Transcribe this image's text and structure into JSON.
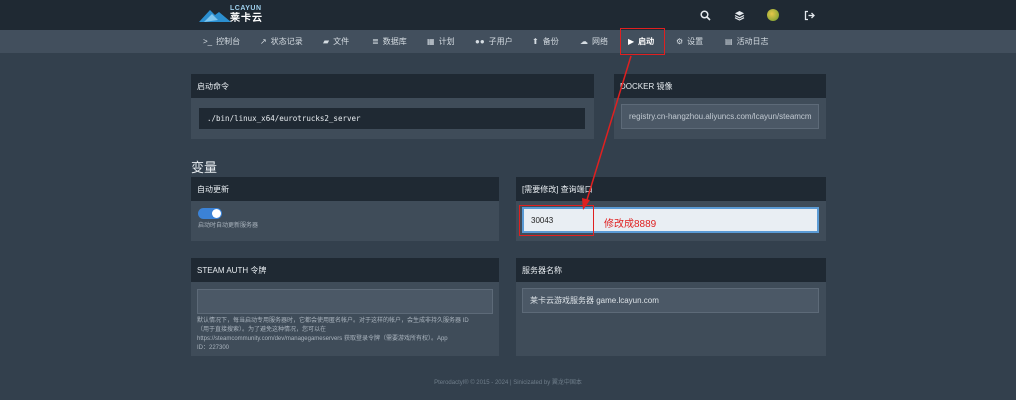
{
  "logo": {
    "text_en": "LCAYUN",
    "text_cn": "莱卡云"
  },
  "header_icons": [
    "search-icon",
    "layers-icon",
    "avatar",
    "logout-icon"
  ],
  "nav": {
    "items": [
      {
        "icon": ">_",
        "label": "控制台"
      },
      {
        "icon": "📈",
        "label": "状态记录"
      },
      {
        "icon": "📁",
        "label": "文件"
      },
      {
        "icon": "🗄",
        "label": "数据库"
      },
      {
        "icon": "📅",
        "label": "计划"
      },
      {
        "icon": "👥",
        "label": "子用户"
      },
      {
        "icon": "⬆",
        "label": "备份"
      },
      {
        "icon": "🖧",
        "label": "网络"
      },
      {
        "icon": "▶",
        "label": "启动"
      },
      {
        "icon": "⚙",
        "label": "设置"
      },
      {
        "icon": "📋",
        "label": "活动日志"
      }
    ],
    "active": "启动"
  },
  "startup": {
    "title": "启动命令",
    "command": "./bin/linux_x64/eurotrucks2_server"
  },
  "docker": {
    "title": "DOCKER 镜像",
    "image": "registry.cn-hangzhou.aliyuncs.com/lcayun/steamcm"
  },
  "variables_title": "变量",
  "auto_update": {
    "title": "自动更新",
    "enabled": true,
    "hint": "启动时自动更新服务器"
  },
  "query_port": {
    "title": "[需要修改] 查询端口",
    "value": "30043"
  },
  "annotation": {
    "text": "修改成8889"
  },
  "steam_auth": {
    "title": "STEAM AUTH 令牌",
    "value": "",
    "hint_lines": [
      "默认情况下，每当启动专用服务器时，它都会使用匿名帐户。对于这样的帐户，会生成非持久服务器 ID",
      "（用于直接搜索）。为了避免这种情况，您可以在",
      "https://steamcommunity.com/dev/managegameservers 获取登录令牌（需要游戏所有权）。App",
      "ID：227300"
    ]
  },
  "server_name": {
    "title": "服务器名称",
    "value": "莱卡云游戏服务器 game.lcayun.com"
  },
  "footer": "Pterodactyl® © 2015 - 2024 | Sinicizated by 翼龙中国本",
  "colors": {
    "accent": "#3b82d6",
    "annotation": "#e02020",
    "topbar": "#1f2933",
    "background": "#33404d"
  }
}
